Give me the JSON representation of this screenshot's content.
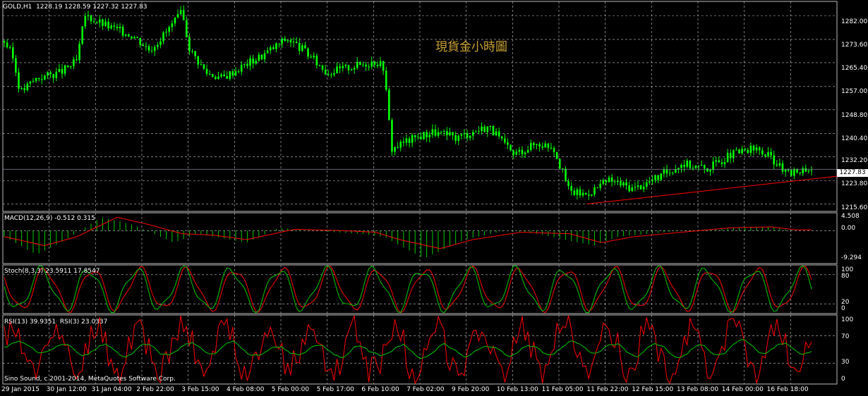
{
  "window": {
    "symbol_header": "GOLD,H1  1228.19 1228.59 1227.32 1227.83",
    "overlay_title": "現貨金小時圖",
    "copyright": "Sino Sound, c 2001-2014, MetaQuotes Software Corp."
  },
  "colors": {
    "background": "#000000",
    "grid": "#c8c8c8",
    "candle": "#00ff00",
    "trendline": "#ff0000",
    "macd_hist": "#00c800",
    "macd_signal": "#ff0000",
    "stoch_main": "#00c800",
    "stoch_signal": "#ff0000",
    "rsi_fast": "#ff0000",
    "rsi_slow": "#00c800",
    "title": "#c8a032"
  },
  "chart_data": [
    {
      "type": "candlestick",
      "name": "main",
      "title": "GOLD,H1",
      "ylim": [
        1213,
        1287
      ],
      "y_ticks": [
        "1282.00",
        "1273.60",
        "1265.40",
        "1257.00",
        "1248.80",
        "1240.40",
        "1232.20",
        "1223.80",
        "1215.60"
      ],
      "current_price": "1227.83",
      "trendline": {
        "from": [
          0.7,
          1215.6
        ],
        "to": [
          1.0,
          1226.5
        ]
      },
      "series": [
        {
          "name": "close",
          "anchors": [
            [
              0.0,
              1273
            ],
            [
              0.01,
              1268
            ],
            [
              0.02,
              1255
            ],
            [
              0.04,
              1260
            ],
            [
              0.07,
              1262
            ],
            [
              0.09,
              1266
            ],
            [
              0.1,
              1282
            ],
            [
              0.13,
              1278
            ],
            [
              0.16,
              1275
            ],
            [
              0.18,
              1270
            ],
            [
              0.2,
              1276
            ],
            [
              0.22,
              1283
            ],
            [
              0.23,
              1270
            ],
            [
              0.25,
              1262
            ],
            [
              0.27,
              1260
            ],
            [
              0.3,
              1265
            ],
            [
              0.32,
              1268
            ],
            [
              0.35,
              1274
            ],
            [
              0.37,
              1270
            ],
            [
              0.4,
              1262
            ],
            [
              0.43,
              1264
            ],
            [
              0.46,
              1266
            ],
            [
              0.47,
              1264
            ],
            [
              0.48,
              1235
            ],
            [
              0.5,
              1238
            ],
            [
              0.53,
              1241
            ],
            [
              0.56,
              1239
            ],
            [
              0.6,
              1243
            ],
            [
              0.63,
              1233
            ],
            [
              0.66,
              1237
            ],
            [
              0.68,
              1236
            ],
            [
              0.7,
              1220
            ],
            [
              0.72,
              1219
            ],
            [
              0.75,
              1224
            ],
            [
              0.78,
              1221
            ],
            [
              0.81,
              1225
            ],
            [
              0.84,
              1230
            ],
            [
              0.87,
              1228
            ],
            [
              0.9,
              1233
            ],
            [
              0.93,
              1235
            ],
            [
              0.95,
              1232
            ],
            [
              0.97,
              1226
            ],
            [
              0.99,
              1228
            ]
          ]
        }
      ]
    },
    {
      "type": "histogram+line",
      "name": "MACD",
      "label": "MACD(12,26,9) -0.512 0.315",
      "ylim": [
        -11,
        6
      ],
      "y_ticks": [
        "4.508",
        "0.00",
        "-9.294"
      ],
      "series": [
        {
          "name": "hist",
          "anchors": [
            [
              0.0,
              -2
            ],
            [
              0.04,
              -8
            ],
            [
              0.07,
              -4
            ],
            [
              0.12,
              4.5
            ],
            [
              0.16,
              2
            ],
            [
              0.21,
              -4
            ],
            [
              0.24,
              -1
            ],
            [
              0.3,
              -4
            ],
            [
              0.34,
              1
            ],
            [
              0.38,
              0
            ],
            [
              0.44,
              -1
            ],
            [
              0.47,
              -2
            ],
            [
              0.52,
              -9.3
            ],
            [
              0.57,
              -3
            ],
            [
              0.62,
              0
            ],
            [
              0.66,
              -1
            ],
            [
              0.73,
              -5
            ],
            [
              0.76,
              -2
            ],
            [
              0.8,
              -1
            ],
            [
              0.84,
              0
            ],
            [
              0.9,
              1
            ],
            [
              0.95,
              1.2
            ],
            [
              0.98,
              0
            ]
          ]
        },
        {
          "name": "signal",
          "anchors": [
            [
              0.0,
              -2
            ],
            [
              0.05,
              -5
            ],
            [
              0.09,
              -2
            ],
            [
              0.14,
              4.5
            ],
            [
              0.18,
              2
            ],
            [
              0.22,
              -1
            ],
            [
              0.26,
              -1.5
            ],
            [
              0.3,
              -3
            ],
            [
              0.36,
              0.5
            ],
            [
              0.42,
              0
            ],
            [
              0.46,
              -0.5
            ],
            [
              0.49,
              -3
            ],
            [
              0.54,
              -6
            ],
            [
              0.58,
              -3
            ],
            [
              0.64,
              -0.5
            ],
            [
              0.7,
              -1
            ],
            [
              0.74,
              -4
            ],
            [
              0.78,
              -2
            ],
            [
              0.84,
              -0.5
            ],
            [
              0.9,
              1
            ],
            [
              0.95,
              1.3
            ],
            [
              0.98,
              0.3
            ]
          ]
        }
      ]
    },
    {
      "type": "line",
      "name": "Stochastic",
      "label": "Stoch(8,3,3) 23.5911 17.8547",
      "ylim": [
        0,
        100
      ],
      "y_ticks": [
        "100",
        "80",
        "20",
        "0"
      ],
      "cycles": 17,
      "seed": 7
    },
    {
      "type": "line",
      "name": "RSI",
      "label": "RSI(13) 39.9351  RSI(3) 23.0337",
      "ylim": [
        0,
        100
      ],
      "y_ticks": [
        "100",
        "70",
        "30",
        "0"
      ],
      "seed": 11
    }
  ],
  "x_axis": {
    "labels": [
      "29 Jan 2015",
      "30 Jan 12:00",
      "31 Jan 04:00",
      "2 Feb 22:00",
      "3 Feb 15:00",
      "4 Feb 08:00",
      "5 Feb 00:00",
      "5 Feb 17:00",
      "6 Feb 10:00",
      "7 Feb 02:00",
      "9 Feb 20:00",
      "10 Feb 13:00",
      "11 Feb 05:00",
      "11 Feb 22:00",
      "12 Feb 15:00",
      "13 Feb 08:00",
      "14 Feb 00:00",
      "16 Feb 18:00"
    ]
  }
}
